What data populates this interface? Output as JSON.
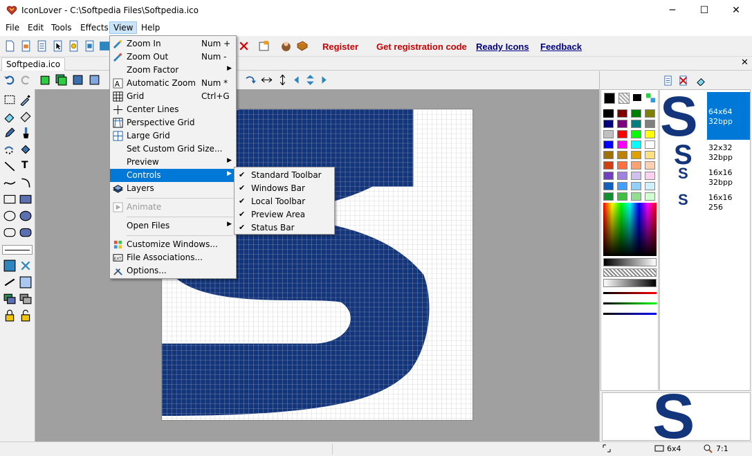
{
  "window": {
    "title": "IconLover - C:\\Softpedia Files\\Softpedia.ico",
    "minimize": "─",
    "maximize": "☐",
    "close": "✕"
  },
  "menubar": {
    "file": "File",
    "edit": "Edit",
    "tools": "Tools",
    "effects": "Effects",
    "view": "View",
    "help": "Help"
  },
  "links": {
    "register": "Register",
    "get_code": "Get registration code",
    "ready_icons": "Ready Icons",
    "feedback": "Feedback"
  },
  "colors": {
    "link_red": "#cc0000",
    "link_blue": "#000080",
    "accent": "#0078d7",
    "icon_blue": "#13357c"
  },
  "tab": {
    "name": "Softpedia.ico",
    "close": "✕"
  },
  "view_menu": [
    {
      "label": "Zoom In",
      "shortcut": "Num +"
    },
    {
      "label": "Zoom Out",
      "shortcut": "Num -"
    },
    {
      "label": "Zoom Factor",
      "shortcut": ""
    },
    {
      "label": "Automatic Zoom",
      "shortcut": "Num *"
    },
    {
      "label": "Grid",
      "shortcut": "Ctrl+G"
    },
    {
      "label": "Center Lines",
      "shortcut": ""
    },
    {
      "label": "Perspective Grid",
      "shortcut": ""
    },
    {
      "label": "Large Grid",
      "shortcut": ""
    },
    {
      "label": "Set Custom Grid Size...",
      "shortcut": ""
    },
    {
      "label": "Preview",
      "shortcut": ""
    },
    {
      "label": "Controls",
      "shortcut": ""
    },
    {
      "label": "Layers",
      "shortcut": ""
    },
    {
      "label": "Animate",
      "shortcut": ""
    },
    {
      "label": "Open Files",
      "shortcut": ""
    },
    {
      "label": "Customize Windows...",
      "shortcut": ""
    },
    {
      "label": "File Associations...",
      "shortcut": ""
    },
    {
      "label": "Options...",
      "shortcut": ""
    }
  ],
  "controls_menu": [
    "Standard Toolbar",
    "Windows Bar",
    "Local Toolbar",
    "Preview Area",
    "Status Bar"
  ],
  "formats": [
    {
      "size": "64x64",
      "depth": "32bpp"
    },
    {
      "size": "32x32",
      "depth": "32bpp"
    },
    {
      "size": "16x16",
      "depth": "32bpp"
    },
    {
      "size": "16x16",
      "depth": "256"
    }
  ],
  "preview_glyph": "S",
  "status": {
    "size": "6x4",
    "zoom": "7:1"
  }
}
